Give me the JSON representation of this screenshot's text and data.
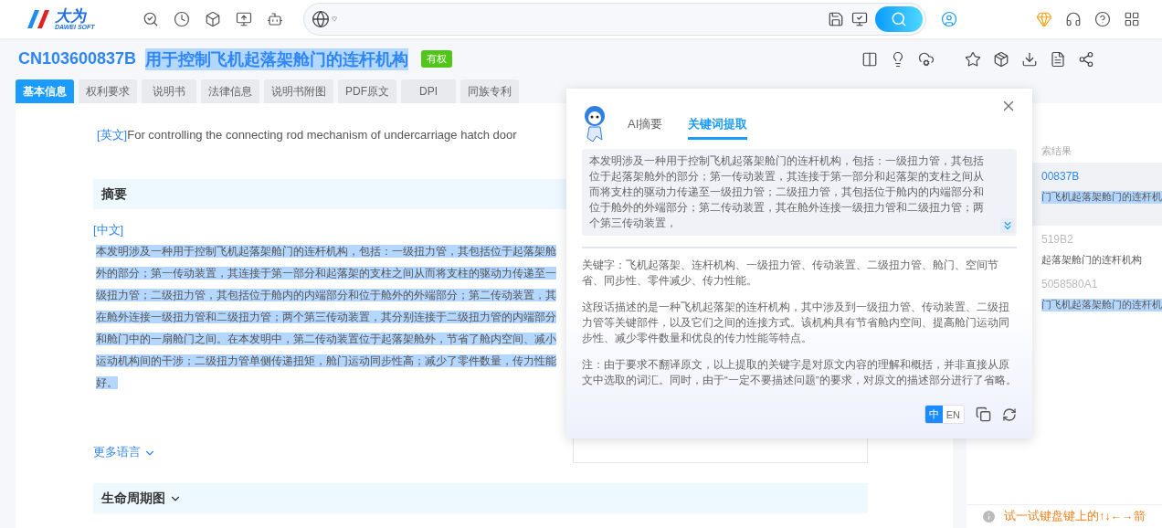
{
  "header": {
    "logo": {
      "name": "大为",
      "subtitle": "DAWEI SOFT"
    }
  },
  "patent": {
    "number": "CN103600837B",
    "title": "用于控制飞机起落架舱门的连杆机构",
    "title_highlighted": true,
    "status": "有权"
  },
  "tabs": [
    {
      "label": "基本信息",
      "selected": true
    },
    {
      "label": "权利要求",
      "selected": false
    },
    {
      "label": "说明书",
      "selected": false
    },
    {
      "label": "法律信息",
      "selected": false
    },
    {
      "label": "说明书附图",
      "selected": false
    },
    {
      "label": "PDF原文",
      "selected": false
    },
    {
      "label": "DPI",
      "selected": false
    },
    {
      "label": "同族专利",
      "selected": false
    }
  ],
  "english_title": {
    "tag": "[英文]",
    "text": "For controlling the connecting rod mechanism of undercarriage hatch door"
  },
  "abstract": {
    "heading": "摘要",
    "tag": "[中文]",
    "highlighted": true,
    "text": "本发明涉及一种用于控制飞机起落架舱门的连杆机构，包括：一级扭力管，其包括位于起落架舱外的部分；第一传动装置，其连接于第一部分和起落架的支柱之间从而将支柱的驱动力传递至一级扭力管；二级扭力管，其包括位于舱内的内端部分和位于舱外的外端部分；第二传动装置，其在舱外连接一级扭力管和二级扭力管；两个第三传动装置，其分别连接于二级扭力管的内端部分和舱门中的一扇舱门之间。在本发明中，第二传动装置位于起落架舱外，节省了舱内空间、减小运动机构间的干涉；二级扭力管单侧传递扭矩，舱门运动同步性高；减少了零件数量，传力性能好。"
  },
  "more_languages": "更多语言",
  "lifecycle": {
    "heading": "生命周期图",
    "expanded": false
  },
  "results_panel": {
    "heading": "索结果",
    "items": [
      {
        "number": "00837B",
        "title": "门飞机起落架舱门的连杆机",
        "selected": true,
        "highlighted": true
      },
      {
        "number": "519B2",
        "title": "起落架舱门的连杆机构",
        "selected": false,
        "highlighted": false
      },
      {
        "number": "5058580A1",
        "title": "门飞机起落架舱门的连杆机",
        "selected": false,
        "highlighted": true
      }
    ],
    "hint": "试一试键盘键上的↑↓←→箭"
  },
  "ai_popup": {
    "tabs": [
      {
        "label": "AI摘要",
        "selected": false
      },
      {
        "label": "关键词提取",
        "selected": true
      }
    ],
    "source_text": "本发明涉及一种用于控制飞机起落架舱门的连杆机构，包括：一级扭力管，其包括位于起落架舱外的部分；第一传动装置，其连接于第一部分和起落架的支柱之间从而将支柱的驱动力传递至一级扭力管；二级扭力管，其包括位于舱内的内端部分和位于舱外的外端部分；第二传动装置，其在舱外连接一级扭力管和二级扭力管；两个第三传动装置，",
    "paragraphs": [
      "关键字：飞机起落架、连杆机构、一级扭力管、传动装置、二级扭力管、舱门、空间节省、同步性、零件减少、传力性能。",
      "这段话描述的是一种飞机起落架的连杆机构，其中涉及到一级扭力管、传动装置、二级扭力管等关键部件，以及它们之间的连接方式。该机构具有节省舱内空间、提高舱门运动同步性、减少零件数量和优良的传力性能等特点。",
      "注：由于要求不翻译原文，以上提取的关键字是对原文内容的理解和概括，并非直接从原文中选取的词汇。同时，由于“一定不要描述问题”的要求，对原文的描述部分进行了省略。"
    ],
    "languages": [
      {
        "label": "中",
        "selected": true
      },
      {
        "label": "EN",
        "selected": false
      }
    ]
  }
}
